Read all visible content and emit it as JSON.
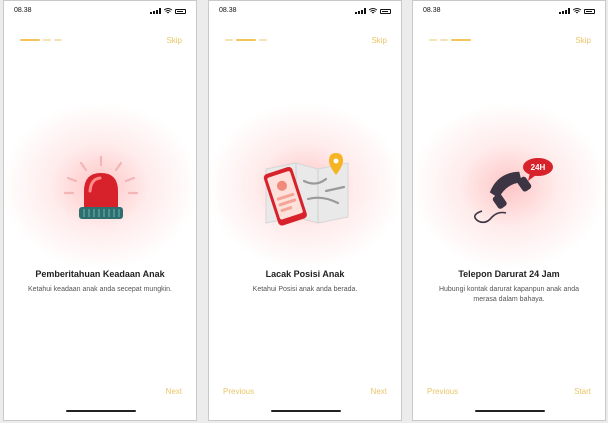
{
  "screens": [
    {
      "time": "08.38",
      "skip_label": "Skip",
      "title": "Pemberitahuan Keadaan Anak",
      "description": "Ketahui keadaan anak anda secepat mungkin.",
      "previous_label": "",
      "next_label": "Next",
      "illustration": "siren-icon"
    },
    {
      "time": "08.38",
      "skip_label": "Skip",
      "title": "Lacak Posisi Anak",
      "description": "Ketahui Posisi anak anda berada.",
      "previous_label": "Previous",
      "next_label": "Next",
      "illustration": "map-phone-icon"
    },
    {
      "time": "08.38",
      "skip_label": "Skip",
      "title": "Telepon Darurat 24 Jam",
      "description": "Hubungi kontak darurat kapanpun anak anda merasa dalam bahaya.",
      "previous_label": "Previous",
      "next_label": "Start",
      "illustration": "phone-24h-icon",
      "badge": "24H"
    }
  ],
  "progress": {
    "screen_count": 3,
    "active": [
      1,
      2,
      3
    ]
  },
  "colors": {
    "accent": "#f5c45a",
    "glow": "#ff9a9a",
    "siren": "#d7222b",
    "phone_dark": "#3d3543"
  }
}
